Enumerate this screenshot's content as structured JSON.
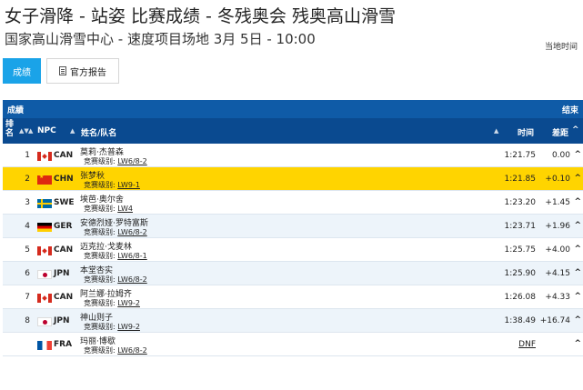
{
  "header": {
    "title": "女子滑降 - 站姿 比赛成绩 - 冬残奥会 残奥高山滑雪",
    "subtitle": "国家高山滑雪中心 - 速度项目场地 3月 5日 - 10:00",
    "local_time_label": "当地时间"
  },
  "tabs": [
    {
      "label": "成绩",
      "active": true
    },
    {
      "label": "官方报告",
      "icon": "document-icon",
      "active": false
    }
  ],
  "panel": {
    "title": "成績",
    "status": "结束"
  },
  "columns": {
    "rank": "排名",
    "npc": "NPC",
    "name": "姓名/队名",
    "time": "时间",
    "diff": "差距"
  },
  "rows": [
    {
      "rank": "1",
      "npc": "CAN",
      "flag": "flag-can",
      "name": "莫莉·杰普森",
      "class_label": "竞赛级别:",
      "class": "LW6/8-2",
      "time": "1:21.75",
      "diff": "0.00",
      "highlight": false
    },
    {
      "rank": "2",
      "npc": "CHN",
      "flag": "flag-chn",
      "name": "张梦秋",
      "class_label": "竞赛级别:",
      "class": "LW9-1",
      "time": "1:21.85",
      "diff": "+0.10",
      "highlight": true
    },
    {
      "rank": "3",
      "npc": "SWE",
      "flag": "flag-swe",
      "name": "埃芭·奥尔舍",
      "class_label": "竞赛级别:",
      "class": "LW4",
      "time": "1:23.20",
      "diff": "+1.45",
      "highlight": false
    },
    {
      "rank": "4",
      "npc": "GER",
      "flag": "flag-ger",
      "name": "安德烈娅·罗特富斯",
      "class_label": "竞赛级别:",
      "class": "LW6/8-2",
      "time": "1:23.71",
      "diff": "+1.96",
      "highlight": false
    },
    {
      "rank": "5",
      "npc": "CAN",
      "flag": "flag-can",
      "name": "迈克拉·戈麦林",
      "class_label": "竞赛级别:",
      "class": "LW6/8-1",
      "time": "1:25.75",
      "diff": "+4.00",
      "highlight": false
    },
    {
      "rank": "6",
      "npc": "JPN",
      "flag": "flag-jpn",
      "name": "本堂杏实",
      "class_label": "竞赛级别:",
      "class": "LW6/8-2",
      "time": "1:25.90",
      "diff": "+4.15",
      "highlight": false
    },
    {
      "rank": "7",
      "npc": "CAN",
      "flag": "flag-can",
      "name": "阿兰娜·拉姆齐",
      "class_label": "竞赛级别:",
      "class": "LW9-2",
      "time": "1:26.08",
      "diff": "+4.33",
      "highlight": false
    },
    {
      "rank": "8",
      "npc": "JPN",
      "flag": "flag-jpn",
      "name": "神山则子",
      "class_label": "竞赛级别:",
      "class": "LW9-2",
      "time": "1:38.49",
      "diff": "+16.74",
      "highlight": false
    },
    {
      "rank": "",
      "npc": "FRA",
      "flag": "flag-fra",
      "name": "玛丽·博歇",
      "class_label": "竞赛级别:",
      "class": "LW6/8-2",
      "time": "DNF",
      "diff": "",
      "highlight": false
    }
  ]
}
